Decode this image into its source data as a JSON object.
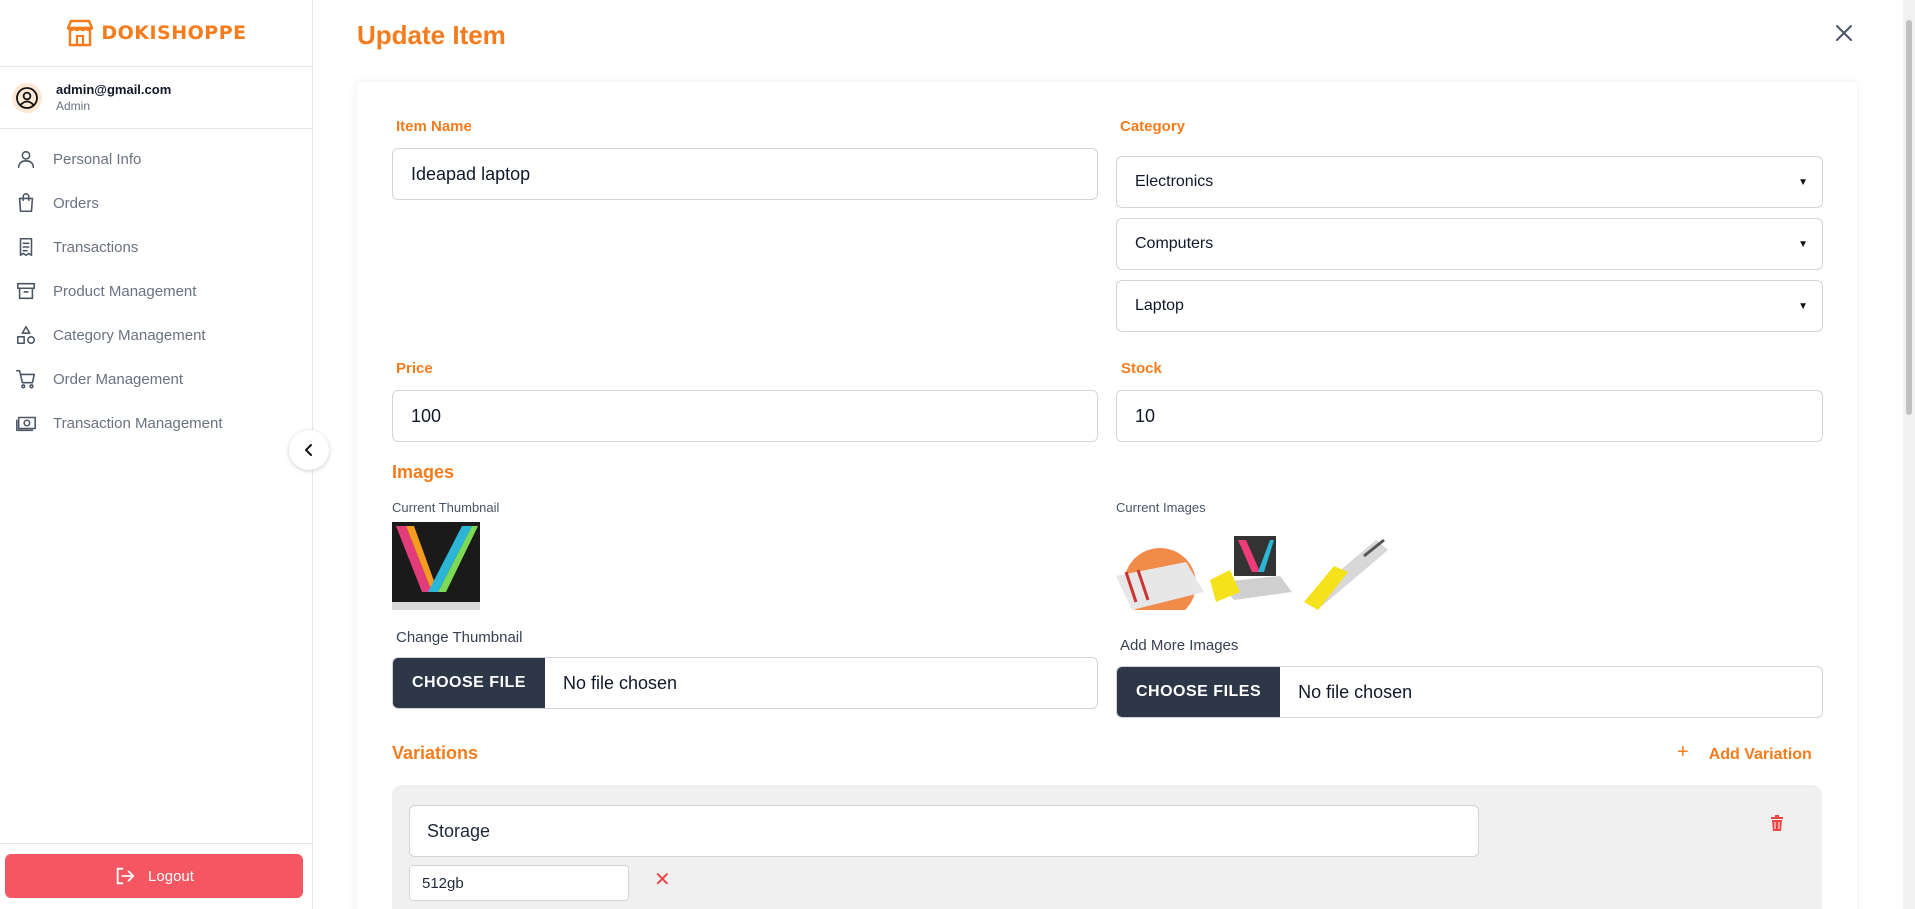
{
  "brand": {
    "name": "DOKISHOPPE",
    "color": "#f47c1c"
  },
  "user": {
    "email": "admin@gmail.com",
    "role": "Admin"
  },
  "nav": [
    {
      "label": "Personal Info",
      "icon": "user-icon"
    },
    {
      "label": "Orders",
      "icon": "shopping-bag-icon"
    },
    {
      "label": "Transactions",
      "icon": "receipt-icon"
    },
    {
      "label": "Product Management",
      "icon": "archive-box-icon"
    },
    {
      "label": "Category Management",
      "icon": "shapes-icon"
    },
    {
      "label": "Order Management",
      "icon": "cart-icon"
    },
    {
      "label": "Transaction Management",
      "icon": "cash-icon"
    }
  ],
  "logout_label": "Logout",
  "page": {
    "title": "Update Item"
  },
  "form": {
    "item_name_label": "Item Name",
    "item_name_value": "Ideapad laptop",
    "category_label": "Category",
    "categories": [
      "Electronics",
      "Computers",
      "Laptop"
    ],
    "price_label": "Price",
    "price_value": "100",
    "stock_label": "Stock",
    "stock_value": "10"
  },
  "images": {
    "title": "Images",
    "current_thumbnail_label": "Current Thumbnail",
    "current_images_label": "Current Images",
    "change_thumbnail_label": "Change Thumbnail",
    "add_more_label": "Add More Images",
    "choose_file_label": "CHOOSE FILE",
    "choose_files_label": "CHOOSE FILES",
    "no_file_text": "No file chosen"
  },
  "variations": {
    "title": "Variations",
    "add_label": "Add Variation",
    "items": [
      {
        "name": "Storage",
        "values": [
          "512gb"
        ]
      }
    ]
  }
}
